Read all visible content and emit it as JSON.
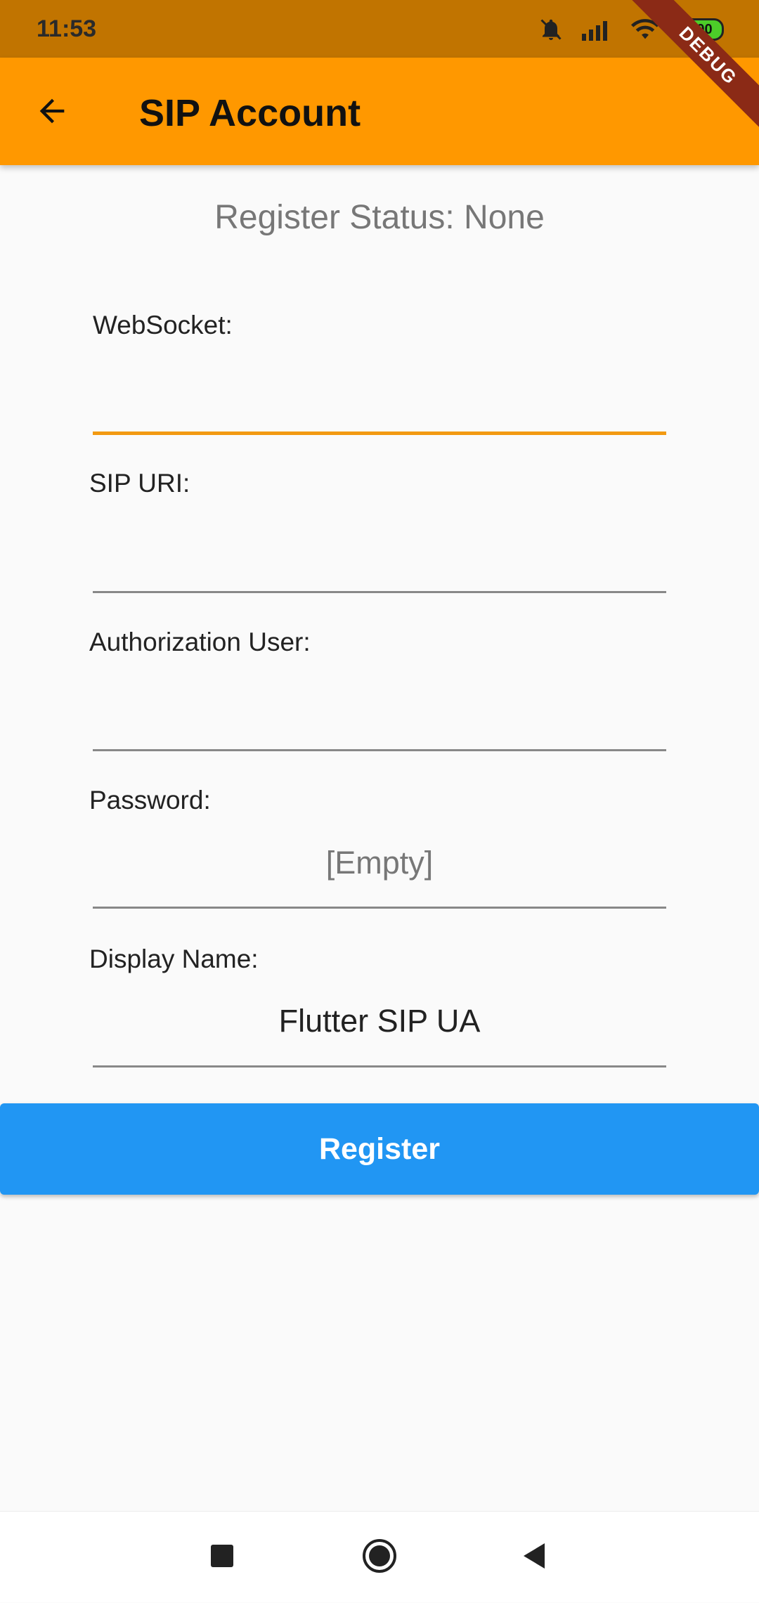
{
  "status_bar": {
    "time": "11:53",
    "battery": "100",
    "debug_banner": "DEBUG"
  },
  "app_bar": {
    "title": "SIP Account"
  },
  "register_status": "Register Status: None",
  "fields": {
    "websocket": {
      "label": "WebSocket:",
      "value": ""
    },
    "sip_uri": {
      "label": "SIP URI:",
      "value": ""
    },
    "authorization_user": {
      "label": "Authorization User:",
      "value": ""
    },
    "password": {
      "label": "Password:",
      "placeholder": "[Empty]",
      "value": ""
    },
    "display_name": {
      "label": "Display Name:",
      "value": "Flutter SIP UA"
    }
  },
  "register_button": {
    "label": "Register"
  },
  "colors": {
    "app_bar": "#ff9800",
    "status_bar": "#c17400",
    "focus_underline": "#f29a11",
    "button": "#2196f3"
  },
  "icons": {
    "back": "arrow-back-icon",
    "mute": "bell-off-icon",
    "signal": "signal-icon",
    "wifi": "wifi-icon",
    "battery": "battery-icon",
    "nav_recents": "square-icon",
    "nav_home": "circle-icon",
    "nav_back": "triangle-back-icon"
  }
}
